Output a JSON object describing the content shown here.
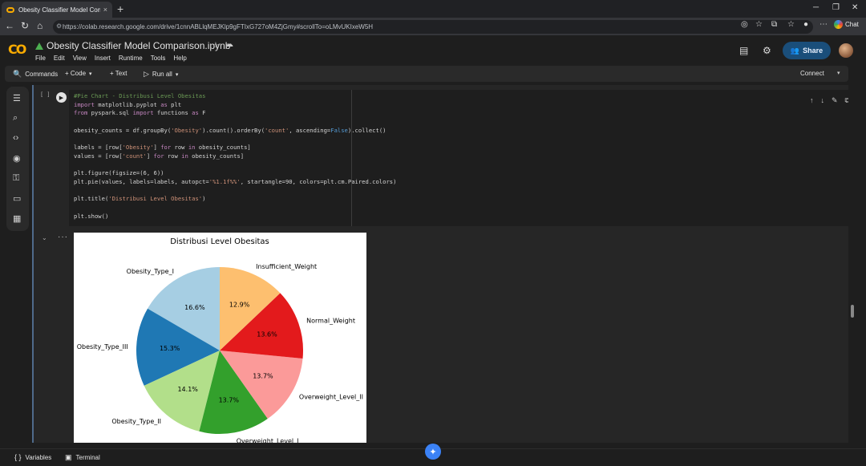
{
  "browser": {
    "tab_title": "Obesity Classifier Model Compariso",
    "tab_close": "×",
    "new_tab": "+",
    "url": "https://colab.research.google.com/drive/1cnnABLlqMEJKlp9gFTIxG727oM4ZjGmy#scrollTo=oLMvUKIxeW5H",
    "chat_label": "Chat"
  },
  "colab": {
    "notebook_title": "Obesity Classifier Model Comparison.ipynb",
    "menu": [
      "File",
      "Edit",
      "View",
      "Insert",
      "Runtime",
      "Tools",
      "Help"
    ],
    "share_label": "Share"
  },
  "command_bar": {
    "commands": "Commands",
    "code": "+ Code",
    "text": "+ Text",
    "run_all": "Run all",
    "connect": "Connect"
  },
  "cell": {
    "bracket": "[ ]",
    "code_lines": [
      "#Pie Chart - Distribusi Level Obesitas",
      "import matplotlib.pyplot as plt",
      "from pyspark.sql import functions as F",
      "",
      "obesity_counts = df.groupBy('Obesity').count().orderBy('count', ascending=False).collect()",
      "",
      "labels = [row['Obesity'] for row in obesity_counts]",
      "values = [row['count'] for row in obesity_counts]",
      "",
      "plt.figure(figsize=(6, 6))",
      "plt.pie(values, labels=labels, autopct='%1.1f%%', startangle=90, colors=plt.cm.Paired.colors)",
      "",
      "plt.title('Distribusi Level Obesitas')",
      "",
      "plt.show()"
    ]
  },
  "bottom": {
    "variables": "Variables",
    "terminal": "Terminal"
  },
  "chart_data": {
    "type": "pie",
    "title": "Distribusi Level Obesitas",
    "start_angle": 90,
    "slices": [
      {
        "label": "Obesity_Type_I",
        "value": 16.6,
        "pct": "16.6%",
        "color": "#a6cee3"
      },
      {
        "label": "Obesity_Type_III",
        "value": 15.3,
        "pct": "15.3%",
        "color": "#1f78b4"
      },
      {
        "label": "Obesity_Type_II",
        "value": 14.1,
        "pct": "14.1%",
        "color": "#b2df8a"
      },
      {
        "label": "Overweight_Level_I",
        "value": 13.7,
        "pct": "13.7%",
        "color": "#33a02c"
      },
      {
        "label": "Overweight_Level_II",
        "value": 13.7,
        "pct": "13.7%",
        "color": "#fb9a99"
      },
      {
        "label": "Normal_Weight",
        "value": 13.6,
        "pct": "13.6%",
        "color": "#e31a1c"
      },
      {
        "label": "Insufficient_Weight",
        "value": 12.9,
        "pct": "12.9%",
        "color": "#fdbf6f"
      }
    ]
  }
}
